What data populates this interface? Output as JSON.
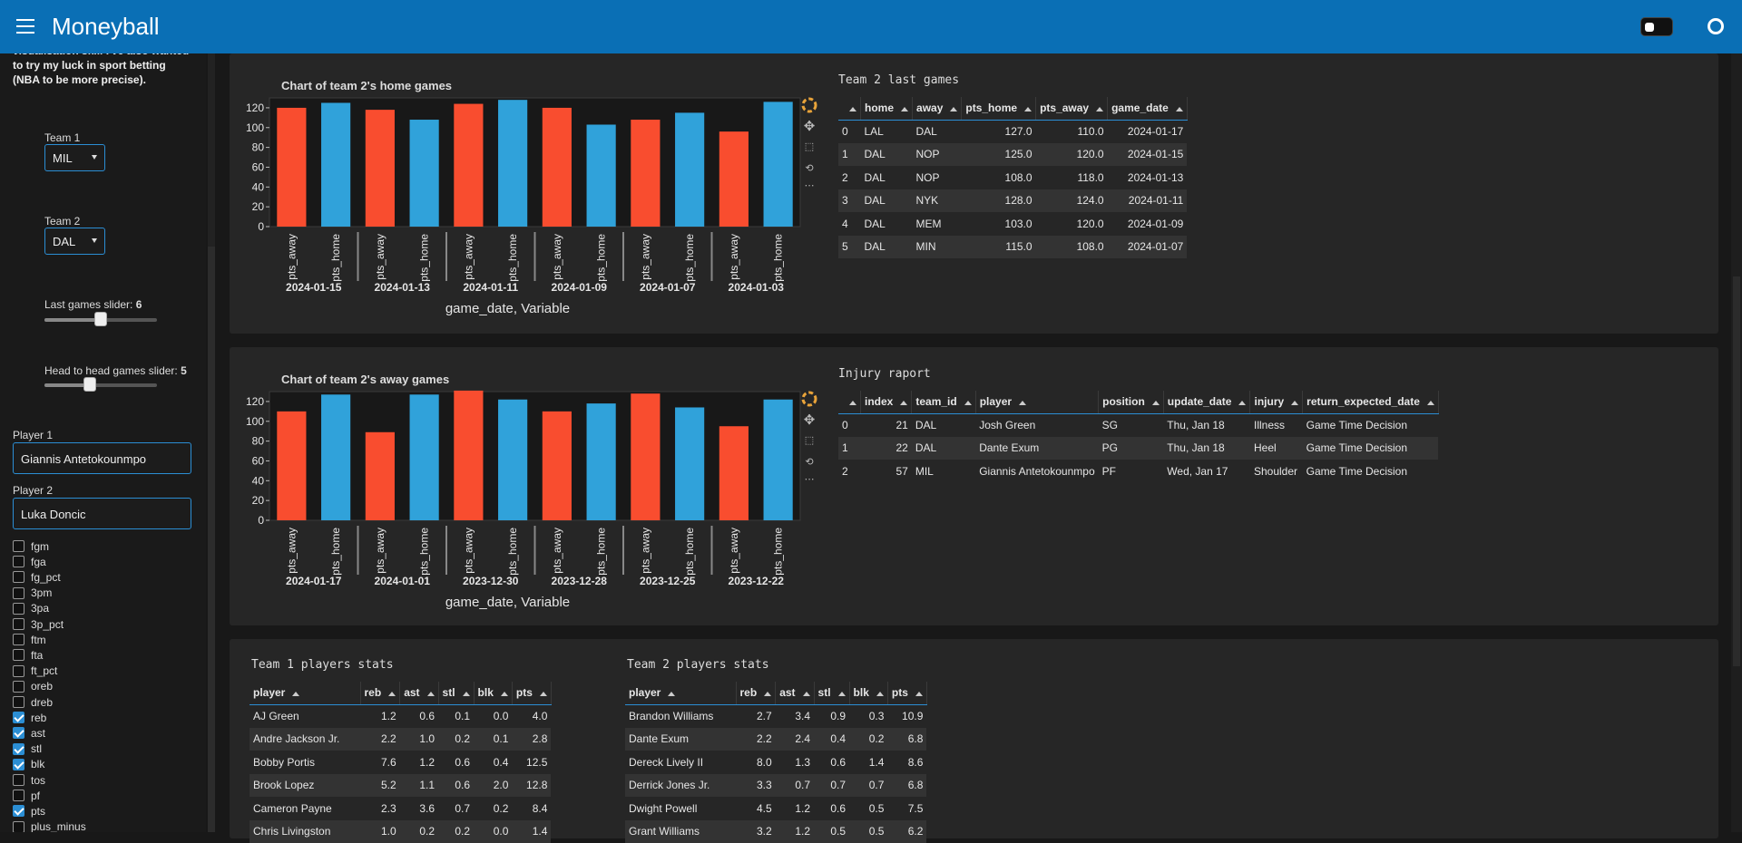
{
  "header": {
    "title": "Moneyball"
  },
  "sidebar": {
    "intro": "visualisation skill I've also wanted to try my luck in sport betting (NBA to be more precise).",
    "team1": {
      "label": "Team 1",
      "value": "MIL"
    },
    "team2": {
      "label": "Team 2",
      "value": "DAL"
    },
    "last_games": {
      "label": "Last games slider:",
      "value": "6",
      "fraction": 0.5
    },
    "h2h_games": {
      "label": "Head to head games slider:",
      "value": "5",
      "fraction": 0.4
    },
    "player1": {
      "label": "Player 1",
      "value": "Giannis Antetokounmpo"
    },
    "player2": {
      "label": "Player 2",
      "value": "Luka Doncic"
    },
    "stats": [
      {
        "name": "fgm",
        "checked": false
      },
      {
        "name": "fga",
        "checked": false
      },
      {
        "name": "fg_pct",
        "checked": false
      },
      {
        "name": "3pm",
        "checked": false
      },
      {
        "name": "3pa",
        "checked": false
      },
      {
        "name": "3p_pct",
        "checked": false
      },
      {
        "name": "ftm",
        "checked": false
      },
      {
        "name": "fta",
        "checked": false
      },
      {
        "name": "ft_pct",
        "checked": false
      },
      {
        "name": "oreb",
        "checked": false
      },
      {
        "name": "dreb",
        "checked": false
      },
      {
        "name": "reb",
        "checked": true
      },
      {
        "name": "ast",
        "checked": true
      },
      {
        "name": "stl",
        "checked": true
      },
      {
        "name": "blk",
        "checked": true
      },
      {
        "name": "tos",
        "checked": false
      },
      {
        "name": "pf",
        "checked": false
      },
      {
        "name": "pts",
        "checked": true
      },
      {
        "name": "plus_minus",
        "checked": false
      }
    ]
  },
  "colors": {
    "pts_away": "#f94d2f",
    "pts_home": "#30a2da",
    "accent": "#2b8ed4",
    "header": "#0a6fb5"
  },
  "home_panel": {
    "table_title": "Team 2 last games",
    "columns": [
      "",
      "home",
      "away",
      "pts_home",
      "pts_away",
      "game_date"
    ],
    "rows": [
      [
        "0",
        "LAL",
        "DAL",
        "127.0",
        "110.0",
        "2024-01-17"
      ],
      [
        "1",
        "DAL",
        "NOP",
        "125.0",
        "120.0",
        "2024-01-15"
      ],
      [
        "2",
        "DAL",
        "NOP",
        "108.0",
        "118.0",
        "2024-01-13"
      ],
      [
        "3",
        "DAL",
        "NYK",
        "128.0",
        "124.0",
        "2024-01-11"
      ],
      [
        "4",
        "DAL",
        "MEM",
        "103.0",
        "120.0",
        "2024-01-09"
      ],
      [
        "5",
        "DAL",
        "MIN",
        "115.0",
        "108.0",
        "2024-01-07"
      ]
    ]
  },
  "away_panel": {
    "table_title": "Injury raport",
    "columns": [
      "",
      "index",
      "team_id",
      "player",
      "position",
      "update_date",
      "injury",
      "return_expected_date"
    ],
    "rows": [
      [
        "0",
        "21",
        "DAL",
        "Josh Green",
        "SG",
        "Thu, Jan 18",
        "Illness",
        "Game Time Decision"
      ],
      [
        "1",
        "22",
        "DAL",
        "Dante Exum",
        "PG",
        "Thu, Jan 18",
        "Heel",
        "Game Time Decision"
      ],
      [
        "2",
        "57",
        "MIL",
        "Giannis Antetokounmpo",
        "PF",
        "Wed, Jan 17",
        "Shoulder",
        "Game Time Decision"
      ]
    ]
  },
  "stats_panel": {
    "team1_title": "Team 1 players stats",
    "team2_title": "Team 2 players stats",
    "columns": [
      "player",
      "reb",
      "ast",
      "stl",
      "blk",
      "pts"
    ],
    "team1_rows": [
      [
        "AJ Green",
        "1.2",
        "0.6",
        "0.1",
        "0.0",
        "4.0"
      ],
      [
        "Andre Jackson Jr.",
        "2.2",
        "1.0",
        "0.2",
        "0.1",
        "2.8"
      ],
      [
        "Bobby Portis",
        "7.6",
        "1.2",
        "0.6",
        "0.4",
        "12.5"
      ],
      [
        "Brook Lopez",
        "5.2",
        "1.1",
        "0.6",
        "2.0",
        "12.8"
      ],
      [
        "Cameron Payne",
        "2.3",
        "3.6",
        "0.7",
        "0.2",
        "8.4"
      ],
      [
        "Chris Livingston",
        "1.0",
        "0.2",
        "0.2",
        "0.0",
        "1.4"
      ]
    ],
    "team2_rows": [
      [
        "Brandon Williams",
        "2.7",
        "3.4",
        "0.9",
        "0.3",
        "10.9"
      ],
      [
        "Dante Exum",
        "2.2",
        "2.4",
        "0.4",
        "0.2",
        "6.8"
      ],
      [
        "Dereck Lively II",
        "8.0",
        "1.3",
        "0.6",
        "1.4",
        "8.6"
      ],
      [
        "Derrick Jones Jr.",
        "3.3",
        "0.7",
        "0.7",
        "0.7",
        "6.8"
      ],
      [
        "Dwight Powell",
        "4.5",
        "1.2",
        "0.6",
        "0.5",
        "7.5"
      ],
      [
        "Grant Williams",
        "3.2",
        "1.2",
        "0.5",
        "0.5",
        "6.2"
      ]
    ]
  },
  "chart_data": [
    {
      "type": "bar",
      "title": "Chart of team 2's home games",
      "xlabel": "game_date, Variable",
      "ylabel": "",
      "ylim": [
        0,
        130
      ],
      "yticks": [
        0,
        20,
        40,
        60,
        80,
        100,
        120
      ],
      "categories": [
        "2024-01-15",
        "2024-01-13",
        "2024-01-11",
        "2024-01-09",
        "2024-01-07",
        "2024-01-03"
      ],
      "sub_categories": [
        "pts_away",
        "pts_home"
      ],
      "series": [
        {
          "name": "pts_away",
          "values": [
            120,
            118,
            124,
            120,
            108,
            96
          ]
        },
        {
          "name": "pts_home",
          "values": [
            125,
            108,
            128,
            103,
            115,
            126
          ]
        }
      ]
    },
    {
      "type": "bar",
      "title": "Chart of team 2's away games",
      "xlabel": "game_date, Variable",
      "ylabel": "",
      "ylim": [
        0,
        130
      ],
      "yticks": [
        0,
        20,
        40,
        60,
        80,
        100,
        120
      ],
      "categories": [
        "2024-01-17",
        "2024-01-01",
        "2023-12-30",
        "2023-12-28",
        "2023-12-25",
        "2023-12-22"
      ],
      "sub_categories": [
        "pts_away",
        "pts_home"
      ],
      "series": [
        {
          "name": "pts_away",
          "values": [
            110,
            89,
            131,
            110,
            128,
            95
          ]
        },
        {
          "name": "pts_home",
          "values": [
            127,
            127,
            122,
            118,
            114,
            122
          ]
        }
      ]
    }
  ]
}
